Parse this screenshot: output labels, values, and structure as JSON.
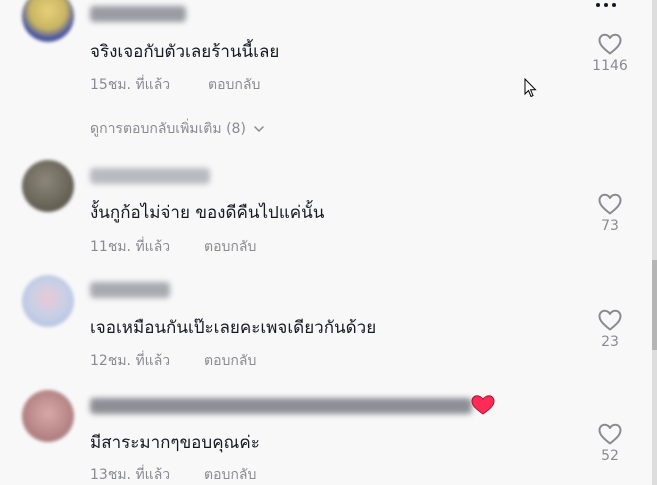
{
  "comments": [
    {
      "text": "จริงเจอกับตัวเลยร้านนี้เลย",
      "time": "15ชม. ที่แล้ว",
      "reply": "ตอบกลับ",
      "likes": "1146",
      "avatar_color": "#c9b463"
    },
    {
      "text": "งั้นกูก้อไม่จ่าย ของดีคืนไปแค่นั้น",
      "time": "11ชม. ที่แล้ว",
      "reply": "ตอบกลับ",
      "likes": "73",
      "avatar_color": "#6e6a5e"
    },
    {
      "text": "เจอเหมือนกันเป๊ะเลยคะเพจเดียวกันด้วย",
      "time": "12ชม. ที่แล้ว",
      "reply": "ตอบกลับ",
      "likes": "23",
      "avatar_color": "#c9d0e6"
    },
    {
      "text": "มีสาระมากๆขอบคุณค่ะ",
      "time": "13ชม. ที่แล้ว",
      "reply": "ตอบกลับ",
      "likes": "52",
      "avatar_color": "#b88788"
    }
  ],
  "view_more_replies": "ดูการตอบกลับเพิ่มเติม (8)",
  "colors": {
    "text": "#161823",
    "muted": "#8a8b91",
    "background": "#f8f8f8",
    "heart_red": "#fe2c55"
  }
}
